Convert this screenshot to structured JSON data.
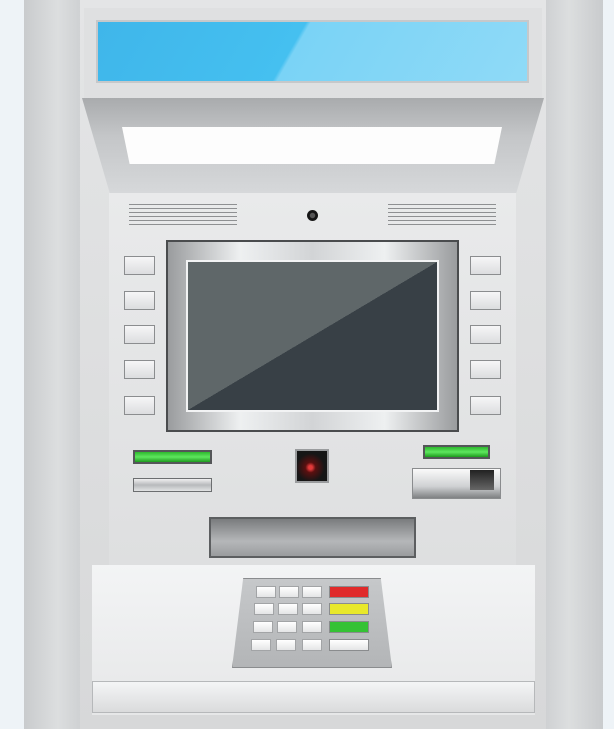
{
  "atm": {
    "banner_color": "#45c0f0",
    "screen_color": "#384046",
    "side_buttons": {
      "left_count": 5,
      "right_count": 5
    },
    "keypad": {
      "number_keys": 12,
      "function_keys": [
        {
          "name": "cancel",
          "color": "#e02a2a"
        },
        {
          "name": "clear",
          "color": "#e8e82a"
        },
        {
          "name": "enter",
          "color": "#35c235"
        },
        {
          "name": "blank",
          "color": "#e4e5e6"
        }
      ]
    },
    "indicator_color": "#3fd43f"
  }
}
